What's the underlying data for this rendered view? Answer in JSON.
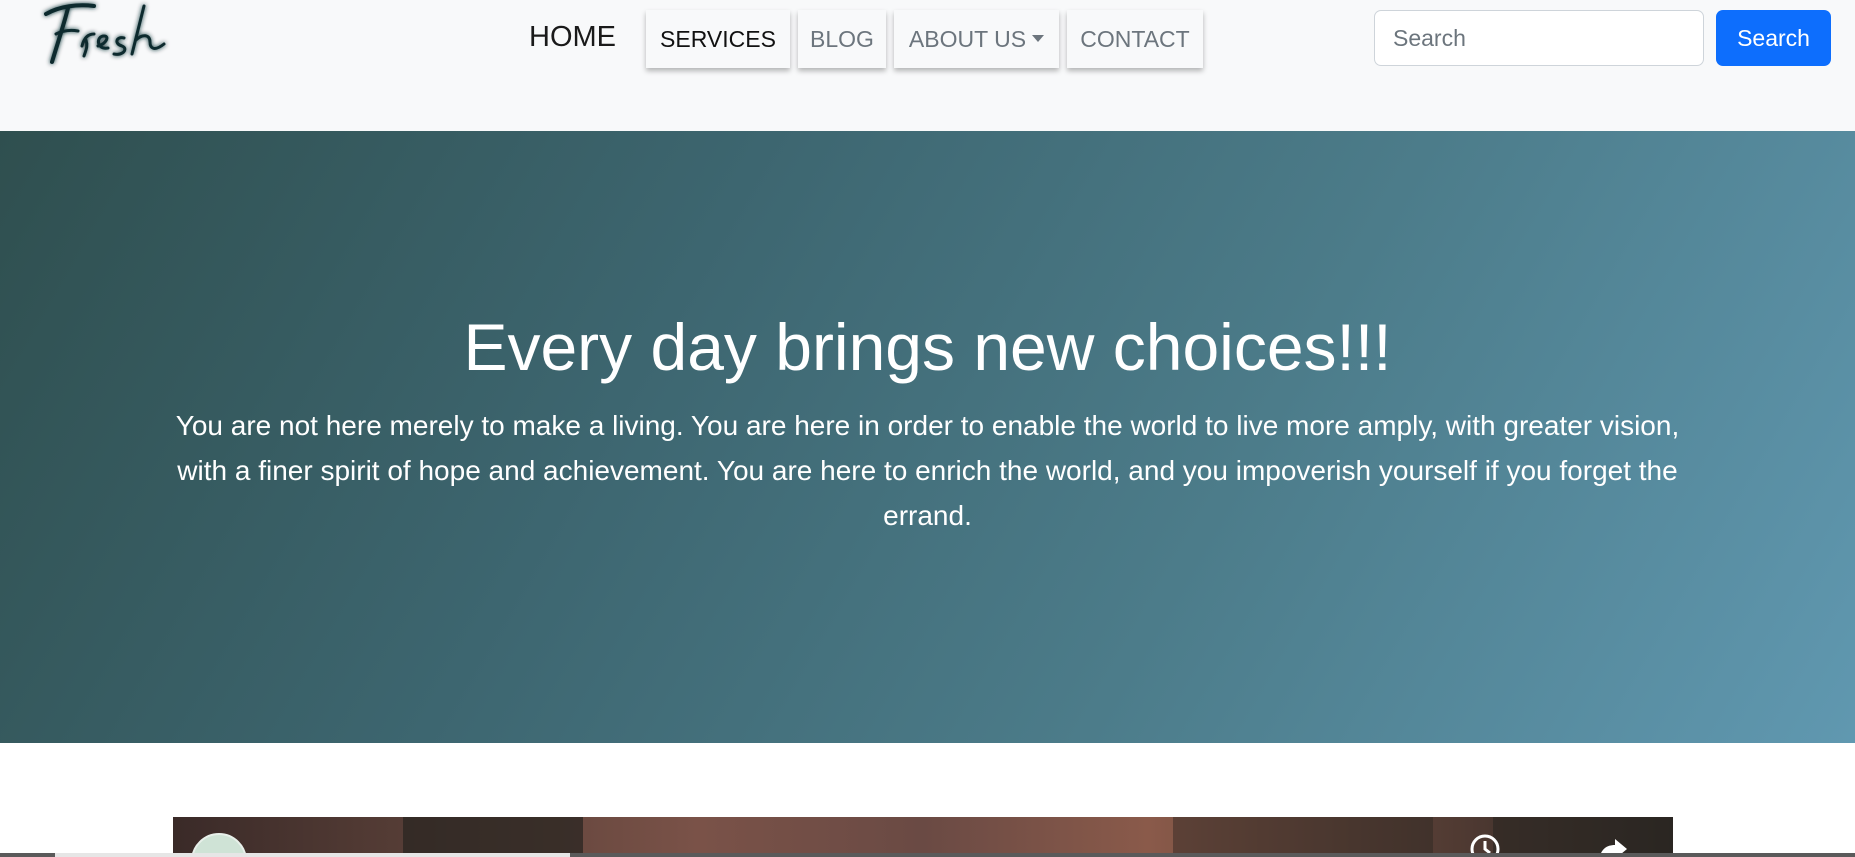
{
  "logo": {
    "text": "Fresh"
  },
  "nav": {
    "home": "HOME",
    "services": "SERVICES",
    "blog": "BLOG",
    "about": "ABOUT US",
    "contact": "CONTACT"
  },
  "search": {
    "placeholder": "Search",
    "button_label": "Search"
  },
  "hero": {
    "title": "Every day brings new choices!!!",
    "text": "You are not here merely to make a living. You are here in order to enable the world to live more amply, with greater vision, with a finer spirit of hope and achievement. You are here to enrich the world, and you impoverish yourself if you forget the errand."
  },
  "video": {
    "icons": [
      "channel-avatar",
      "watch-later-icon",
      "share-icon"
    ]
  },
  "colors": {
    "navbar_bg": "#f8f9fa",
    "primary": "#0d6efd",
    "hero_gradient_start": "#2f4f4f",
    "hero_gradient_end": "#6098b0"
  }
}
